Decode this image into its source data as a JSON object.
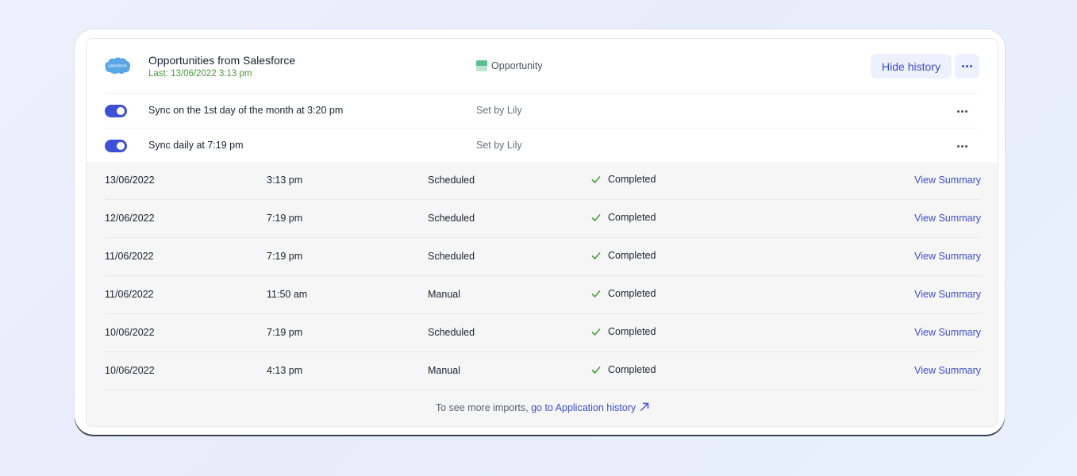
{
  "header": {
    "title": "Opportunities from Salesforce",
    "last_sync": "Last: 13/06/2022 3:13 pm",
    "object_label": "Opportunity",
    "hide_history_label": "Hide history",
    "logo_text": "salesforce"
  },
  "schedules": [
    {
      "label": "Sync on the 1st day of the month at 3:20 pm",
      "set_by": "Set by Lily",
      "enabled": true
    },
    {
      "label": "Sync daily at 7:19 pm",
      "set_by": "Set by Lily",
      "enabled": true
    }
  ],
  "history": [
    {
      "date": "13/06/2022",
      "time": "3:13 pm",
      "type": "Scheduled",
      "status": "Completed",
      "action": "View Summary"
    },
    {
      "date": "12/06/2022",
      "time": "7:19 pm",
      "type": "Scheduled",
      "status": "Completed",
      "action": "View Summary"
    },
    {
      "date": "11/06/2022",
      "time": "7:19 pm",
      "type": "Scheduled",
      "status": "Completed",
      "action": "View Summary"
    },
    {
      "date": "11/06/2022",
      "time": "11:50 am",
      "type": "Manual",
      "status": "Completed",
      "action": "View Summary"
    },
    {
      "date": "10/06/2022",
      "time": "7:19 pm",
      "type": "Scheduled",
      "status": "Completed",
      "action": "View Summary"
    },
    {
      "date": "10/06/2022",
      "time": "4:13 pm",
      "type": "Manual",
      "status": "Completed",
      "action": "View Summary"
    }
  ],
  "footer": {
    "prefix": "To see more imports,",
    "link": "go to Application history"
  },
  "colors": {
    "accent": "#3e4ecb",
    "success": "#4c9a3c",
    "salesforce": "#5aa6e6"
  },
  "icons": [
    "salesforce-logo-icon",
    "opportunity-object-icon",
    "more-dots-icon",
    "checkmark-icon",
    "external-arrow-icon"
  ]
}
